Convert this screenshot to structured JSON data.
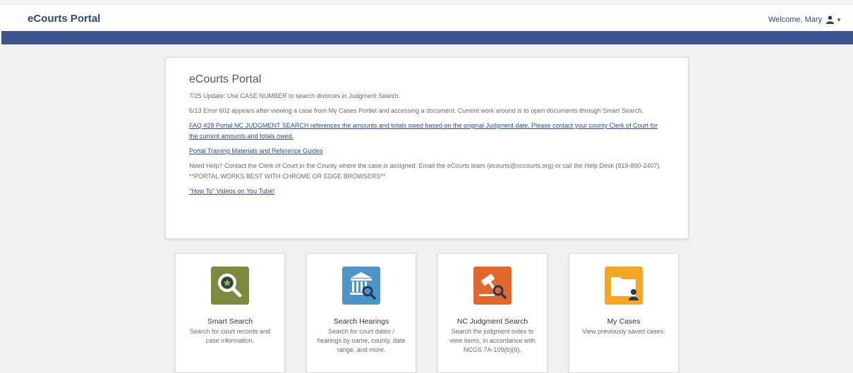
{
  "header": {
    "brand": "eCourts Portal",
    "welcome": "Welcome, Mary"
  },
  "notice": {
    "title": "eCourts Portal",
    "line1": "7/25 Update: Use CASE NUMBER to search divorces in Judgment Search.",
    "line2": "6/13 Error 602 appears after viewing a case from My Cases Portlet and accessing a document. Current work around is to open documents through Smart Search.",
    "faq_link": "FAQ #28 Portal NC JUDGMENT SEARCH references the amounts and totals owed based on the original Judgment date. Please contact your county Clerk of Court for the current amounts and totals owed.",
    "training_link": "Portal Training Materials and Reference Guides",
    "help_text": "Need Help? Contact the Clerk of Court in the County where the case is assigned. Email the eCourts team (ecourts@nccourts.org) or call the Help Desk (919-890-2407). **PORTAL WORKS BEST WITH CHROME OR EDGE BROWSERS**",
    "videos_link": "\"How To\" Videos on You Tube!"
  },
  "tiles": [
    {
      "title": "Smart Search",
      "desc": "Search for court records and case information.",
      "icon": "magnifier-icon",
      "color": "#7c8a3e"
    },
    {
      "title": "Search Hearings",
      "desc": "Search for court dates / hearings by name, county, date range, and more.",
      "icon": "courthouse-icon",
      "color": "#4d95c6"
    },
    {
      "title": "NC Judgment Search",
      "desc": "Search the judgment index to view items, in accordance with NCGS 7A-109(b)(6).",
      "icon": "gavel-icon",
      "color": "#e3672d"
    },
    {
      "title": "My Cases",
      "desc": "View previously saved cases.",
      "icon": "folder-user-icon",
      "color": "#f5a623"
    }
  ],
  "colors": {
    "header_band": "#3f5590",
    "brand": "#2b4a77"
  }
}
